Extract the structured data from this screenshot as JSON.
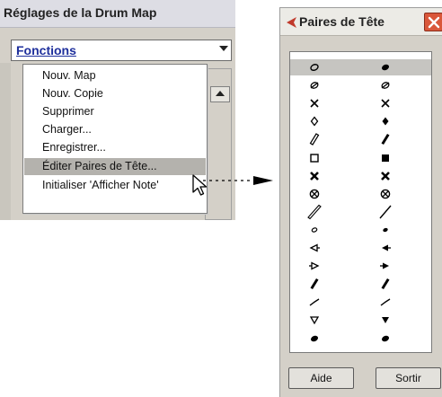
{
  "left_panel": {
    "title": "Réglages de la Drum Map",
    "fonctions": "Fonctions",
    "menu": [
      {
        "label": "Nouv. Map"
      },
      {
        "label": "Nouv. Copie"
      },
      {
        "label": "Supprimer"
      },
      {
        "label": "Charger..."
      },
      {
        "label": "Enregistrer..."
      },
      {
        "label": "Éditer Paires de Tête...",
        "highlighted": true
      },
      {
        "label": "Initialiser 'Afficher Note'"
      }
    ]
  },
  "dialog": {
    "title": "Paires de Tête",
    "pairs": [
      {
        "left": "note-open-icon",
        "right": "note-filled-icon",
        "selected": true
      },
      {
        "left": "note-slash-icon",
        "right": "note-slash-icon"
      },
      {
        "left": "x-icon",
        "right": "x-icon"
      },
      {
        "left": "diamond-open-icon",
        "right": "diamond-filled-icon"
      },
      {
        "left": "slash-open-icon",
        "right": "slash-filled-icon"
      },
      {
        "left": "square-open-icon",
        "right": "square-filled-icon"
      },
      {
        "left": "x-bold-icon",
        "right": "x-bold-icon"
      },
      {
        "left": "circle-x-icon",
        "right": "circle-x-icon"
      },
      {
        "left": "long-slash-open-icon",
        "right": "long-slash-icon"
      },
      {
        "left": "small-note-open-icon",
        "right": "small-note-filled-icon"
      },
      {
        "left": "triangle-left-open-icon",
        "right": "triangle-left-filled-icon"
      },
      {
        "left": "triangle-right-open-icon",
        "right": "triangle-right-filled-icon"
      },
      {
        "left": "slash-filled-icon",
        "right": "slash-filled-icon"
      },
      {
        "left": "tick-icon",
        "right": "tick-icon"
      },
      {
        "left": "triangle-down-open-icon",
        "right": "triangle-down-filled-icon"
      },
      {
        "left": "note-filled-icon",
        "right": "note-filled-icon"
      }
    ],
    "buttons": {
      "help": "Aide",
      "exit": "Sortir"
    }
  },
  "colors": {
    "link": "#1e2f9c",
    "panel": "#d4d0c8",
    "selection": "#c6c5c1",
    "close": "#d9573a"
  }
}
